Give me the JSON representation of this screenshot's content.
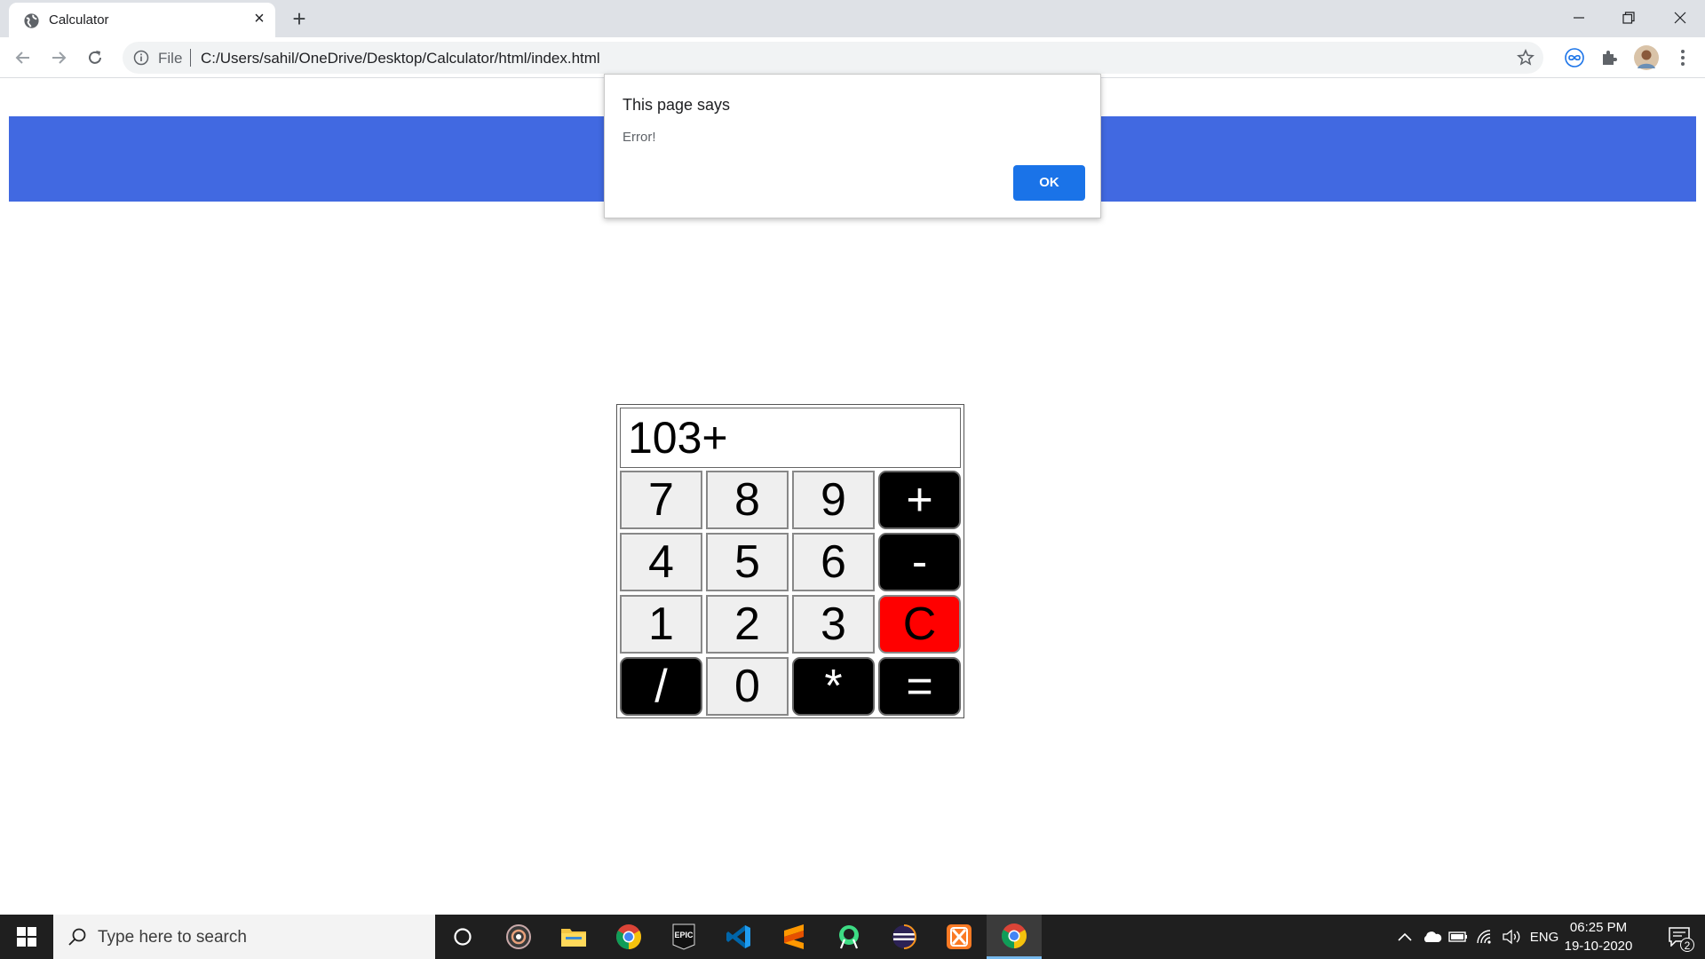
{
  "browser": {
    "tab_title": "Calculator",
    "address_scheme": "File",
    "address_url": "C:/Users/sahil/OneDrive/Desktop/Calculator/html/index.html"
  },
  "dialog": {
    "title": "This page says",
    "message": "Error!",
    "ok_label": "OK"
  },
  "calculator": {
    "display": "103+",
    "keys": [
      {
        "label": "7",
        "kind": "digit"
      },
      {
        "label": "8",
        "kind": "digit"
      },
      {
        "label": "9",
        "kind": "digit"
      },
      {
        "label": "+",
        "kind": "operator"
      },
      {
        "label": "4",
        "kind": "digit"
      },
      {
        "label": "5",
        "kind": "digit"
      },
      {
        "label": "6",
        "kind": "digit"
      },
      {
        "label": "-",
        "kind": "operator"
      },
      {
        "label": "1",
        "kind": "digit"
      },
      {
        "label": "2",
        "kind": "digit"
      },
      {
        "label": "3",
        "kind": "digit"
      },
      {
        "label": "C",
        "kind": "clear"
      },
      {
        "label": "/",
        "kind": "operator"
      },
      {
        "label": "0",
        "kind": "digit"
      },
      {
        "label": "*",
        "kind": "operator"
      },
      {
        "label": "=",
        "kind": "operator"
      }
    ]
  },
  "colors": {
    "header": "#4169e1",
    "operator_key": "#000000",
    "clear_key": "#ff0000",
    "digit_key": "#efefef",
    "dialog_button": "#1a73e8"
  },
  "taskbar": {
    "search_placeholder": "Type here to search",
    "apps": [
      "cortana-icon",
      "obs-icon",
      "file-explorer-icon",
      "chrome-icon",
      "epic-games-icon",
      "vscode-icon",
      "sublime-text-icon",
      "android-studio-icon",
      "eclipse-icon",
      "xampp-icon",
      "chrome-active-icon"
    ],
    "epic_label": "EPIC",
    "language": "ENG",
    "time": "06:25 PM",
    "date": "19-10-2020",
    "notification_count": "2"
  }
}
